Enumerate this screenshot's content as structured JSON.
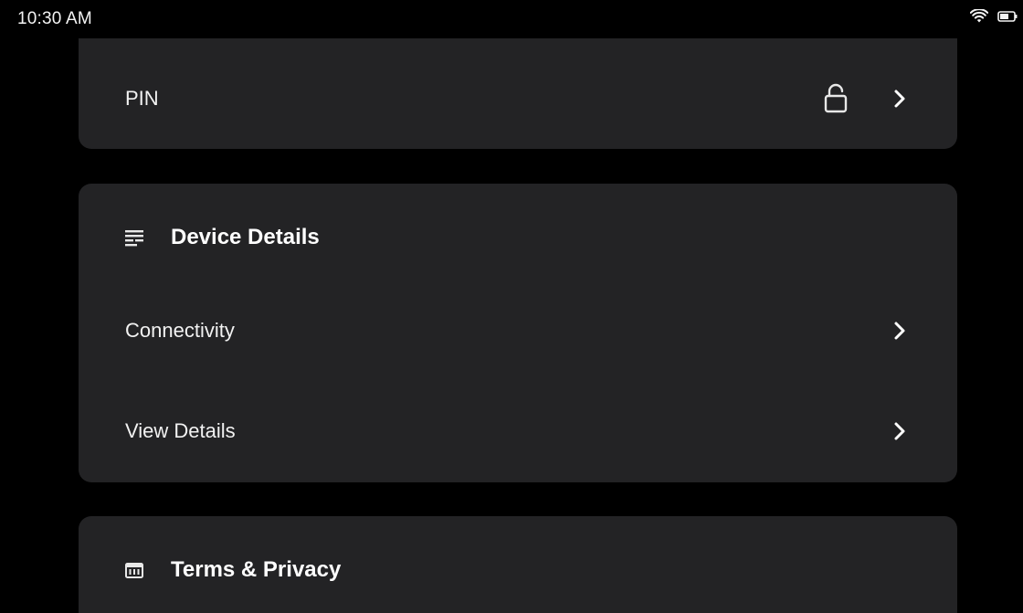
{
  "status_bar": {
    "time": "10:30 AM",
    "icons": [
      "wifi-icon",
      "battery-icon"
    ]
  },
  "pin_card": {
    "label": "PIN",
    "icons": [
      "unlocked-lock-icon",
      "chevron-right-icon"
    ]
  },
  "device_details": {
    "title": "Device Details",
    "icon": "details-list-icon",
    "items": [
      {
        "label": "Connectivity",
        "icon": "chevron-right-icon"
      },
      {
        "label": "View Details",
        "icon": "chevron-right-icon"
      }
    ]
  },
  "terms": {
    "title": "Terms & Privacy",
    "icon": "bank-building-icon"
  },
  "colors": {
    "background": "#000000",
    "card": "#232325",
    "text": "#f2f2f2"
  }
}
